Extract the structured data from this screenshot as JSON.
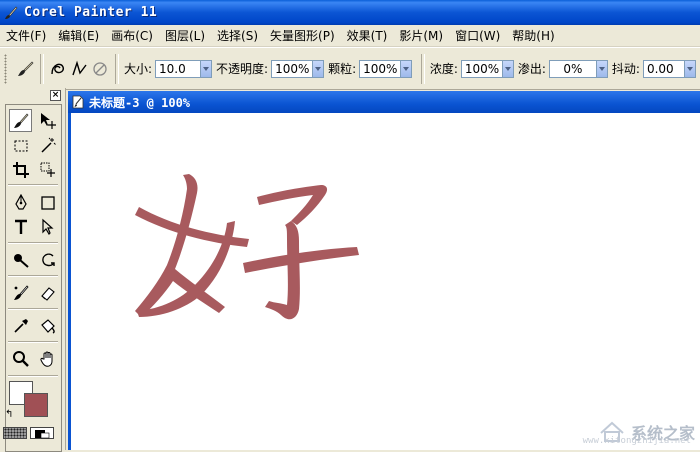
{
  "window": {
    "title": "Corel Painter 11"
  },
  "menu": [
    "文件(F)",
    "编辑(E)",
    "画布(C)",
    "图层(L)",
    "选择(S)",
    "矢量图形(P)",
    "效果(T)",
    "影片(M)",
    "窗口(W)",
    "帮助(H)"
  ],
  "toolbar": {
    "size": {
      "label": "大小:",
      "value": "10.0"
    },
    "opacity": {
      "label": "不透明度:",
      "value": "100%"
    },
    "grain": {
      "label": "颗粒:",
      "value": "100%"
    },
    "concentration": {
      "label": "浓度:",
      "value": "100%"
    },
    "bleed": {
      "label": "渗出:",
      "value": "0%"
    },
    "jitter": {
      "label": "抖动:",
      "value": "0.00"
    }
  },
  "document": {
    "title": "未标题-3 @ 100%"
  },
  "toolbox": {
    "close_label": "×",
    "swap_label": "↰"
  },
  "colors": {
    "primary": "#ffffff",
    "secondary": "#a05055",
    "stroke": "#a85a5e",
    "titlebar": "#0a54d2"
  },
  "canvas": {
    "drawn_text": "女子"
  },
  "watermark": {
    "text": "系统之家",
    "url": "www.xitongzhijia.net"
  }
}
